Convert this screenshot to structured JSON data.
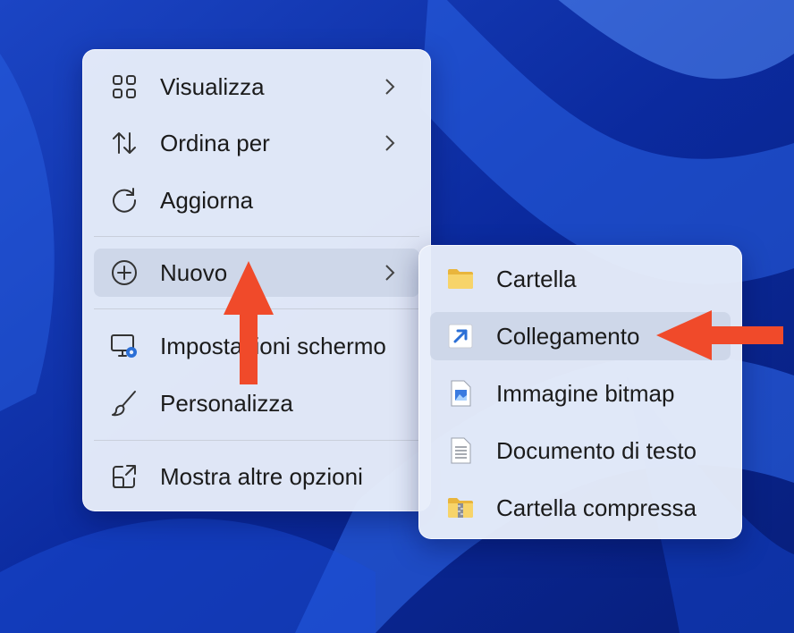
{
  "main_menu": {
    "items": [
      {
        "label": "Visualizza",
        "icon": "grid-icon",
        "has_submenu": true
      },
      {
        "label": "Ordina per",
        "icon": "sort-icon",
        "has_submenu": true
      },
      {
        "label": "Aggiorna",
        "icon": "refresh-icon",
        "has_submenu": false
      },
      {
        "label": "Nuovo",
        "icon": "plus-circle-icon",
        "has_submenu": true,
        "highlighted": true
      },
      {
        "label": "Impostazioni schermo",
        "icon": "display-settings-icon",
        "has_submenu": false
      },
      {
        "label": "Personalizza",
        "icon": "brush-icon",
        "has_submenu": false
      },
      {
        "label": "Mostra altre opzioni",
        "icon": "open-external-icon",
        "has_submenu": false
      }
    ]
  },
  "new_submenu": {
    "items": [
      {
        "label": "Cartella",
        "icon": "folder-icon"
      },
      {
        "label": "Collegamento",
        "icon": "shortcut-icon",
        "highlighted": true
      },
      {
        "label": "Immagine bitmap",
        "icon": "bitmap-file-icon"
      },
      {
        "label": "Documento di testo",
        "icon": "text-file-icon"
      },
      {
        "label": "Cartella compressa",
        "icon": "zip-folder-icon"
      }
    ]
  },
  "colors": {
    "menu_bg": "#e8eefa",
    "highlight_bg": "#c8d2e4",
    "annotation_arrow": "#f04a2a",
    "accent": "#2b6fd6",
    "folder": "#f2c14e",
    "wallpaper": "#0a2fa0"
  }
}
